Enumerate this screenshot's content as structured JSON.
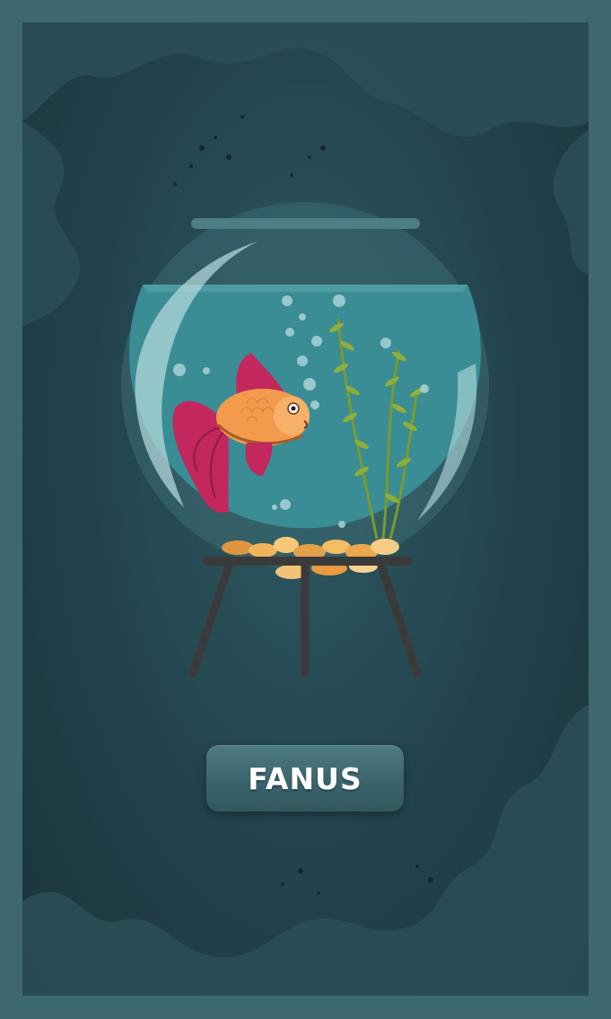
{
  "scene": {
    "illustration": "goldfish-in-bowl-on-stand",
    "icons": [
      "fishbowl-icon",
      "goldfish-icon",
      "seaweed-icon",
      "bubbles-icon",
      "stand-icon"
    ]
  },
  "button": {
    "label": "FANUS"
  },
  "colors": {
    "frame": "#3d6870",
    "background": "#244650",
    "water": "#3a8c95",
    "fish_body": "#f39a4c",
    "fish_fins": "#c2275e",
    "plant": "#7a9a2e",
    "stand": "#3a3a3a"
  }
}
